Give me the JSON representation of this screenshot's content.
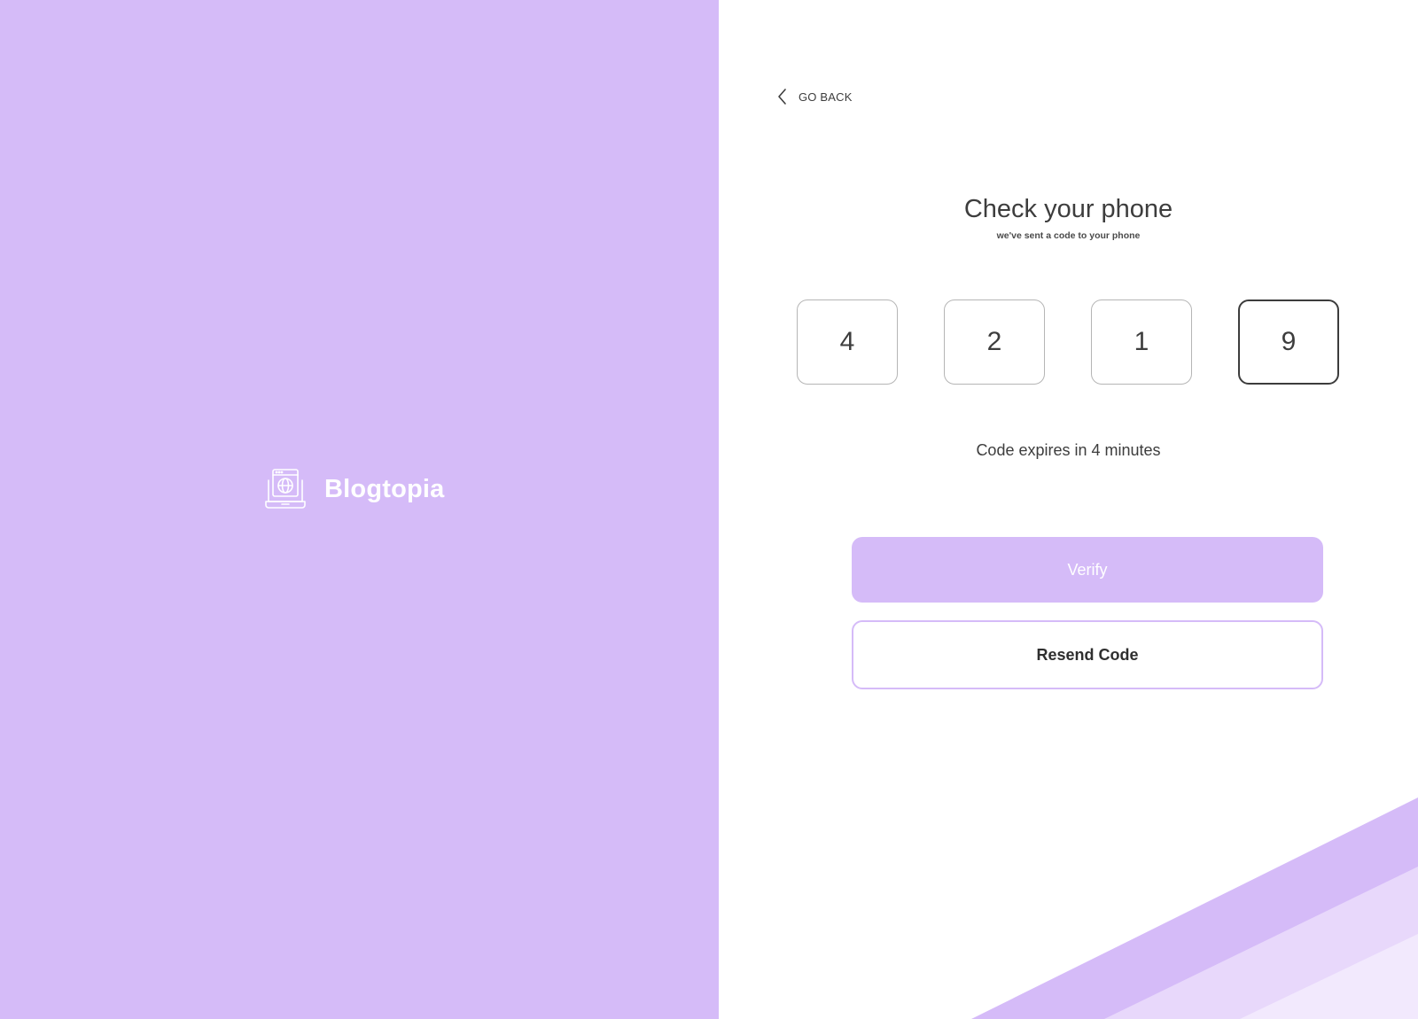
{
  "brand": {
    "name": "Blogtopia",
    "icon": "laptop-globe-icon"
  },
  "nav": {
    "go_back_label": "GO BACK",
    "icon": "chevron-left-icon"
  },
  "verification": {
    "title": "Check your phone",
    "subtitle": "we've sent a code to your phone",
    "code_digits": [
      "4",
      "2",
      "1",
      "9"
    ],
    "expiry_text": "Code expires in 4 minutes"
  },
  "actions": {
    "verify_label": "Verify",
    "resend_label": "Resend Code"
  },
  "colors": {
    "accent": "#d5bbf8",
    "accent_light": "#e8d8fb",
    "accent_lighter": "#f2e9fd",
    "text": "#3d3d3d"
  }
}
